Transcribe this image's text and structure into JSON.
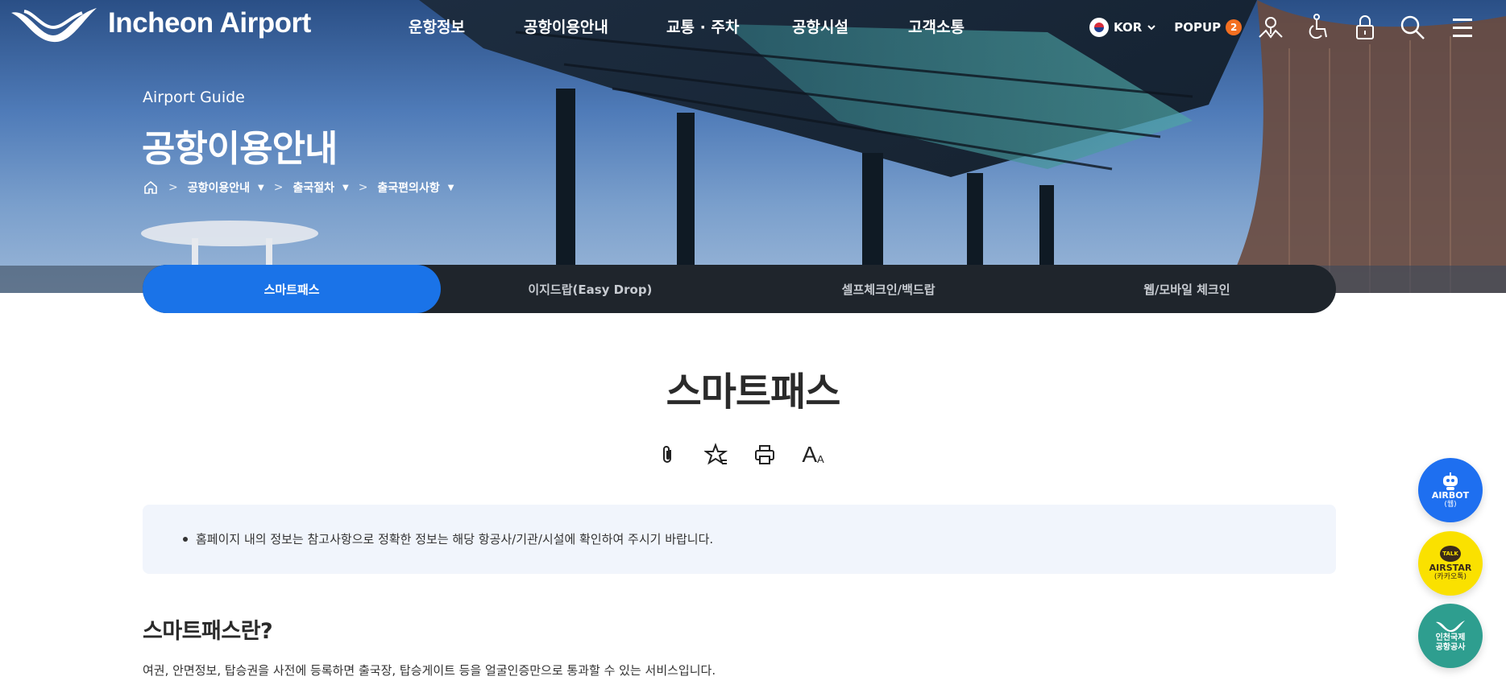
{
  "header": {
    "logo_text": "Incheon Airport",
    "nav": [
      "운항정보",
      "공항이용안내",
      "교통 · 주차",
      "공항시설",
      "고객소통"
    ],
    "language": "KOR",
    "popup_label": "POPUP",
    "popup_count": "2"
  },
  "hero": {
    "subtitle": "Airport Guide",
    "title": "공항이용안내",
    "breadcrumb": [
      "공항이용안내",
      "출국절차",
      "출국편의사항"
    ]
  },
  "tabs": [
    "스마트패스",
    "이지드랍(Easy Drop)",
    "셀프체크인/백드랍",
    "웹/모바일 체크인"
  ],
  "content": {
    "page_title": "스마트패스",
    "font_size_label": "A",
    "font_size_small": "A",
    "notice": "홈페이지 내의 정보는 참고사항으로 정확한 정보는 해당 항공사/기관/시설에 확인하여 주시기 바랍니다.",
    "section_title": "스마트패스란?",
    "section_body": "여권, 안면정보, 탑승권을 사전에 등록하면 출국장, 탑승게이트 등을 얼굴인증만으로 통과할 수 있는 서비스입니다."
  },
  "floating": {
    "airbot_title": "AIRBOT",
    "airbot_sub": "(웹)",
    "airstar_icon_text": "TALK",
    "airstar_title": "AIRSTAR",
    "airstar_sub": "(카카오톡)",
    "corp_line1": "인천국제",
    "corp_line2": "공항공사"
  },
  "colors": {
    "accent_blue": "#1a73e8",
    "tab_bar": "#1f252c",
    "popup_badge": "#f36f21",
    "airstar_yellow": "#fae100",
    "corp_teal": "#2e9e8f"
  }
}
